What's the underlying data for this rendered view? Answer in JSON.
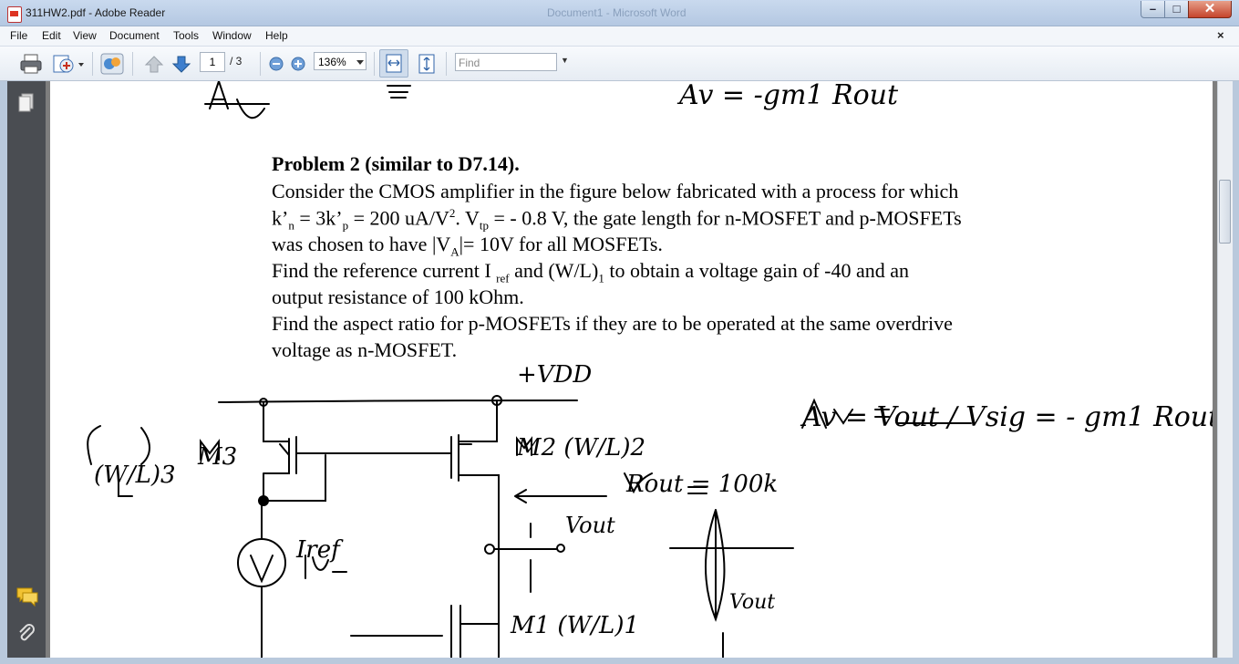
{
  "window": {
    "title": "311HW2.pdf - Adobe Reader",
    "background_title": "Document1 - Microsoft Word",
    "minimize_glyph": "–",
    "maximize_glyph": "□",
    "close_glyph": "✕"
  },
  "menu": {
    "items": [
      "File",
      "Edit",
      "View",
      "Document",
      "Tools",
      "Window",
      "Help"
    ],
    "close_doc": "×"
  },
  "toolbar": {
    "current_page": "1",
    "total_pages": "/ 3",
    "zoom": "136%",
    "find_placeholder": "Find"
  },
  "document": {
    "problem_heading": "Problem 2  (similar to D7.14).",
    "line1": "Consider the CMOS amplifier in the figure below fabricated with a process for which",
    "line2_a": "k’",
    "line2_a_sub": "n",
    "line2_b": " = 3k’",
    "line2_b_sub": "p",
    "line2_c": " = 200 uA/V",
    "line2_c_sup": "2",
    "line2_d": ".  V",
    "line2_d_sub": "tp",
    "line2_e": " = - 0.8 V,  the gate length for  n-MOSFET and p-MOSFETs",
    "line3_a": "was chosen to have |V",
    "line3_a_sub": "A",
    "line3_b": "|= 10V  for all MOSFETs.",
    "line4_a": "Find the reference current I ",
    "line4_a_sub": "ref",
    "line4_b": " and (W/L)",
    "line4_b_sub": "1",
    "line4_c": " to obtain a voltage gain of -40 and an",
    "line5": "output resistance of 100 kOhm.",
    "line6": "Find the aspect ratio for p-MOSFETs if they are to be operated at the same overdrive",
    "line7": "voltage as n-MOSFET."
  },
  "handwriting": {
    "top_gain": "Av = -gm1 Rout",
    "vdd": "+VDD",
    "w_l_3": "(W/L)3",
    "m3": "M3",
    "m2": "M2 (W/L)2",
    "rout": "Rout = 100k",
    "vout": "Vout",
    "iref": "Iref",
    "m1": "M1 (W/L)1",
    "gain_eq": "Av = Vout / Vsig = - gm1 Rout",
    "vout_wave": "Vout"
  },
  "colors": {
    "left_panel": "#4a4d52",
    "doc_background": "#7e7e7e",
    "titlebar": "#c9d9ee"
  }
}
